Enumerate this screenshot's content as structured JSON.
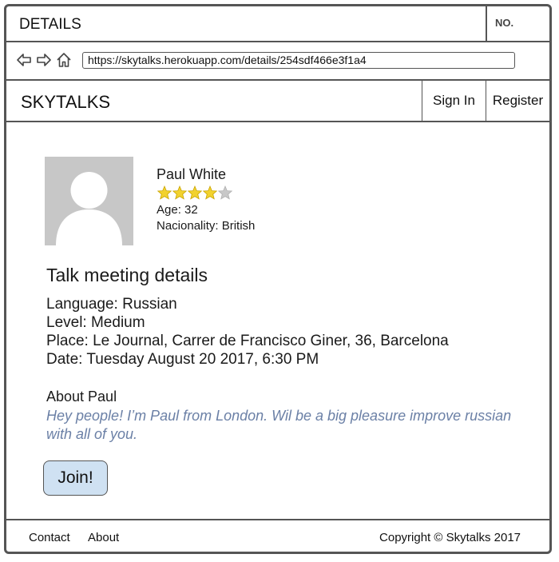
{
  "window": {
    "title": "DETAILS",
    "no_label": "NO."
  },
  "addressbar": {
    "url": "https://skytalks.herokuapp.com/details/254sdf466e3f1a4"
  },
  "header": {
    "brand": "SKYTALKS",
    "sign_in": "Sign In",
    "register": "Register"
  },
  "profile": {
    "name": "Paul White",
    "rating": 4,
    "rating_max": 5,
    "age": "Age: 32",
    "nationality": "Nacionality: British"
  },
  "talk": {
    "title": "Talk meeting details",
    "language": "Language: Russian",
    "level": "Level: Medium",
    "place": "Place: Le Journal, Carrer de Francisco Giner, 36, Barcelona",
    "date": "Date: Tuesday August 20 2017, 6:30 PM"
  },
  "about": {
    "title": "About Paul",
    "text": "Hey people! I’m Paul from London. Wil be a big pleasure improve russian with all of you."
  },
  "join_label": "Join!",
  "footer": {
    "contact": "Contact",
    "about": "About",
    "copyright": "Copyright © Skytalks 2017"
  },
  "colors": {
    "accent_text": "#6b80a6",
    "join_bg": "#cfe1f2",
    "avatar_bg": "#c7c7c7",
    "star_fill": "#f2d22e",
    "star_empty": "#c8c8c8"
  },
  "icons": [
    "back-arrow-icon",
    "forward-arrow-icon",
    "home-icon",
    "star-icon"
  ]
}
